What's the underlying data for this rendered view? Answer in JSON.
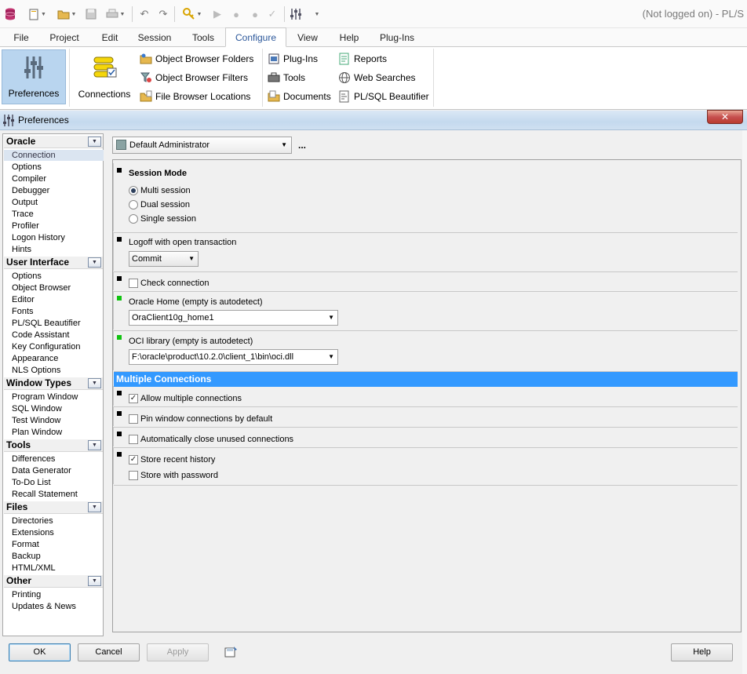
{
  "window": {
    "title": "(Not logged on) - PL/S"
  },
  "menu": {
    "tabs": [
      "File",
      "Project",
      "Edit",
      "Session",
      "Tools",
      "Configure",
      "View",
      "Help",
      "Plug-Ins"
    ],
    "active": "Configure"
  },
  "ribbon": {
    "preferences": "Preferences",
    "connections": "Connections",
    "object_browser_folders": "Object Browser Folders",
    "object_browser_filters": "Object Browser Filters",
    "file_browser_locations": "File Browser Locations",
    "plug_ins": "Plug-Ins",
    "tools": "Tools",
    "documents": "Documents",
    "reports": "Reports",
    "web_searches": "Web Searches",
    "plsql_beautifier": "PL/SQL Beautifier"
  },
  "dialog": {
    "title": "Preferences",
    "close": "✕",
    "nav": [
      {
        "header": "Oracle",
        "items": [
          "Connection",
          "Options",
          "Compiler",
          "Debugger",
          "Output",
          "Trace",
          "Profiler",
          "Logon History",
          "Hints"
        ]
      },
      {
        "header": "User Interface",
        "items": [
          "Options",
          "Object Browser",
          "Editor",
          "Fonts",
          "PL/SQL Beautifier",
          "Code Assistant",
          "Key Configuration",
          "Appearance",
          "NLS Options"
        ]
      },
      {
        "header": "Window Types",
        "items": [
          "Program Window",
          "SQL Window",
          "Test Window",
          "Plan Window"
        ]
      },
      {
        "header": "Tools",
        "items": [
          "Differences",
          "Data Generator",
          "To-Do List",
          "Recall Statement"
        ]
      },
      {
        "header": "Files",
        "items": [
          "Directories",
          "Extensions",
          "Format",
          "Backup",
          "HTML/XML"
        ]
      },
      {
        "header": "Other",
        "items": [
          "Printing",
          "Updates & News"
        ]
      }
    ],
    "selected_nav": "Connection",
    "profile": "Default Administrator",
    "profile_more": "...",
    "session_mode": {
      "label": "Session Mode",
      "options": [
        "Multi session",
        "Dual session",
        "Single session"
      ],
      "selected": "Multi session"
    },
    "logoff": {
      "label": "Logoff with open transaction",
      "value": "Commit"
    },
    "check_connection": {
      "label": "Check connection",
      "checked": false
    },
    "oracle_home": {
      "label": "Oracle Home (empty is autodetect)",
      "value": "OraClient10g_home1"
    },
    "oci_library": {
      "label": "OCI library (empty is autodetect)",
      "value": "F:\\oracle\\product\\10.2.0\\client_1\\bin\\oci.dll"
    },
    "multiple_connections": {
      "header": "Multiple Connections",
      "allow": {
        "label": "Allow multiple connections",
        "checked": true
      },
      "pin": {
        "label": "Pin window connections by default",
        "checked": false
      },
      "auto_close": {
        "label": "Automatically close unused connections",
        "checked": false
      },
      "store_history": {
        "label": "Store recent history",
        "checked": true
      },
      "store_password": {
        "label": "Store with password",
        "checked": false
      }
    },
    "buttons": {
      "ok": "OK",
      "cancel": "Cancel",
      "apply": "Apply",
      "help": "Help"
    }
  },
  "colors": {
    "accent": "#3399ff",
    "selected_tab": "#2b579a",
    "modified_marker": "#11c311"
  }
}
